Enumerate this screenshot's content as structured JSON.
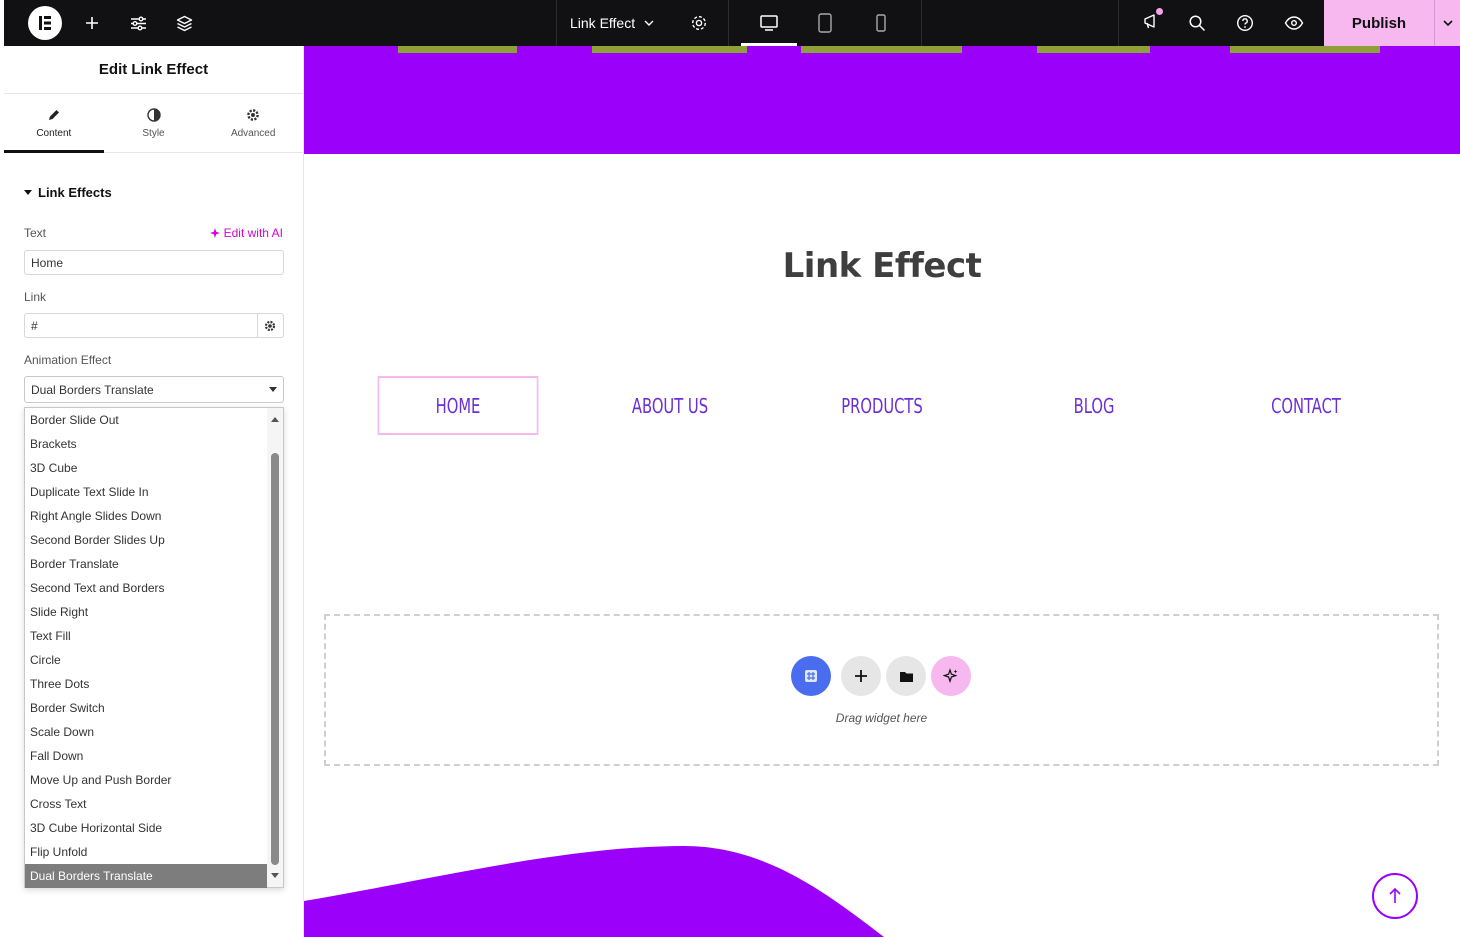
{
  "topbar": {
    "document_title": "Link Effect",
    "publish_label": "Publish",
    "icons": [
      "elementor-logo-icon",
      "add-icon",
      "settings-sliders-icon",
      "layers-icon",
      "chevron-down-icon",
      "gear-icon",
      "desktop-icon",
      "tablet-icon",
      "mobile-icon",
      "megaphone-icon",
      "search-icon",
      "help-icon",
      "eye-icon"
    ]
  },
  "panel": {
    "title": "Edit Link Effect",
    "tabs": [
      {
        "label": "Content",
        "icon": "pencil-icon",
        "active": true
      },
      {
        "label": "Style",
        "icon": "half-circle-icon",
        "active": false
      },
      {
        "label": "Advanced",
        "icon": "gear-icon",
        "active": false
      }
    ],
    "section_title": "Link Effects",
    "text_label": "Text",
    "edit_ai_label": "Edit with AI",
    "text_value": "Home",
    "link_label": "Link",
    "link_value": "#",
    "animation_label": "Animation Effect",
    "animation_value": "Dual Borders Translate",
    "animation_options": [
      "Border Slide Out",
      "Brackets",
      "3D Cube",
      "Duplicate Text Slide In",
      "Right Angle Slides Down",
      "Second Border Slides Up",
      "Border Translate",
      "Second Text and Borders",
      "Slide Right",
      "Text Fill",
      "Circle",
      "Three Dots",
      "Border Switch",
      "Scale Down",
      "Fall Down",
      "Move Up and Push Border",
      "Cross Text",
      "3D Cube Horizontal Side",
      "Flip Unfold",
      "Dual Borders Translate"
    ]
  },
  "canvas": {
    "heading": "Link Effect",
    "nav_links": [
      {
        "label": "HOME",
        "active": true
      },
      {
        "label": "ABOUT US",
        "active": false
      },
      {
        "label": "PRODUCTS",
        "active": false
      },
      {
        "label": "BLOG",
        "active": false
      },
      {
        "label": "CONTACT",
        "active": false
      }
    ],
    "drop_zone_text": "Drag widget here"
  },
  "colors": {
    "accent_purple": "#9b00fb",
    "publish_pink": "#f6b8ef",
    "nav_text": "#6b2fd6",
    "olive": "#8ea03a",
    "topbar_bg": "#111113"
  }
}
